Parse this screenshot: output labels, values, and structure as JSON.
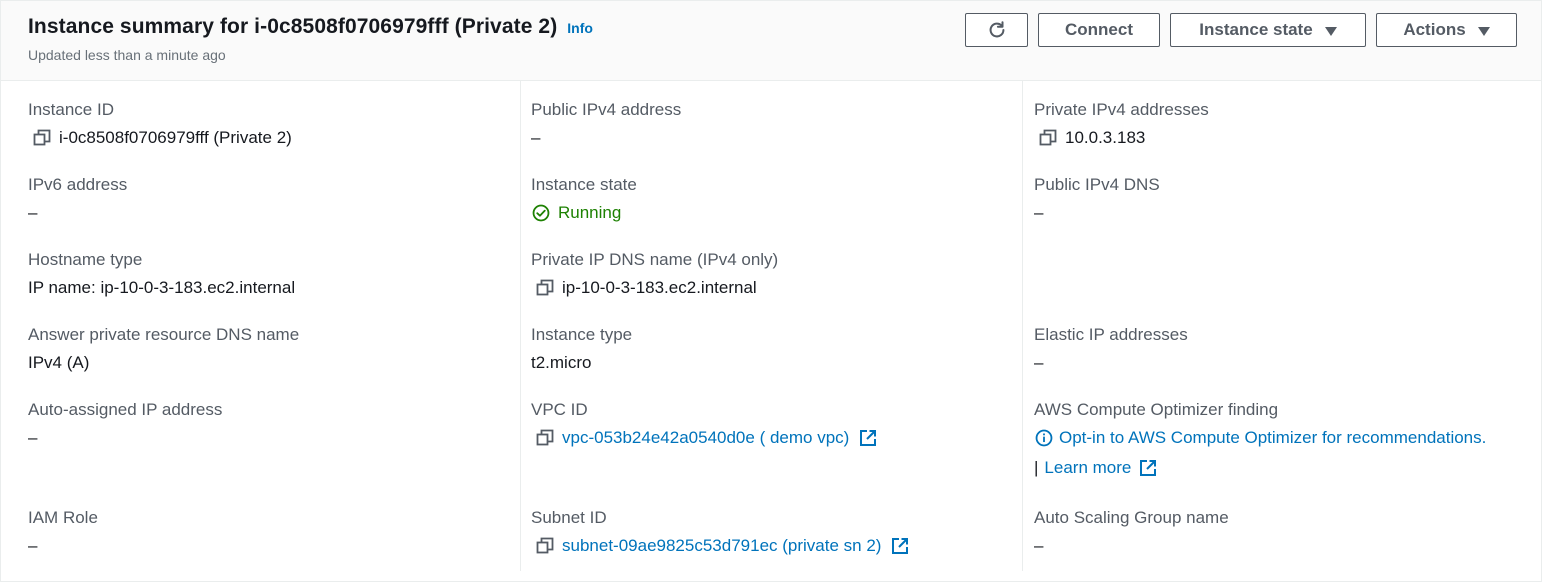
{
  "header": {
    "title": "Instance summary for i-0c8508f0706979fff (Private 2)",
    "info_label": "Info",
    "subtitle": "Updated less than a minute ago",
    "buttons": {
      "refresh_icon": "refresh-icon",
      "connect": "Connect",
      "instance_state": "Instance state",
      "actions": "Actions"
    }
  },
  "fields": {
    "instance_id": {
      "label": "Instance ID",
      "value": "i-0c8508f0706979fff (Private 2)"
    },
    "public_ipv4": {
      "label": "Public IPv4 address",
      "value": "–"
    },
    "private_ipv4": {
      "label": "Private IPv4 addresses",
      "value": "10.0.3.183"
    },
    "ipv6": {
      "label": "IPv6 address",
      "value": "–"
    },
    "instance_state": {
      "label": "Instance state",
      "value": "Running"
    },
    "public_dns": {
      "label": "Public IPv4 DNS",
      "value": "–"
    },
    "hostname_type": {
      "label": "Hostname type",
      "value": "IP name: ip-10-0-3-183.ec2.internal"
    },
    "private_dns": {
      "label": "Private IP DNS name (IPv4 only)",
      "value": "ip-10-0-3-183.ec2.internal"
    },
    "answer_dns": {
      "label": "Answer private resource DNS name",
      "value": "IPv4 (A)"
    },
    "instance_type": {
      "label": "Instance type",
      "value": "t2.micro"
    },
    "elastic_ip": {
      "label": "Elastic IP addresses",
      "value": "–"
    },
    "auto_ip": {
      "label": "Auto-assigned IP address",
      "value": "–"
    },
    "vpc_id": {
      "label": "VPC ID",
      "value": "vpc-053b24e42a0540d0e ( demo vpc)"
    },
    "optimizer": {
      "label": "AWS Compute Optimizer finding",
      "value": "Opt-in to AWS Compute Optimizer for recommendations.",
      "pipe": "|",
      "learn_more": "Learn more"
    },
    "iam_role": {
      "label": "IAM Role",
      "value": "–"
    },
    "subnet_id": {
      "label": "Subnet ID",
      "value": "subnet-09ae9825c53d791ec (private sn 2)"
    },
    "asg_name": {
      "label": "Auto Scaling Group name",
      "value": "–"
    }
  },
  "colors": {
    "link": "#0073bb",
    "running": "#1d8102",
    "label": "#545b64",
    "header_bg": "#fafafa"
  }
}
